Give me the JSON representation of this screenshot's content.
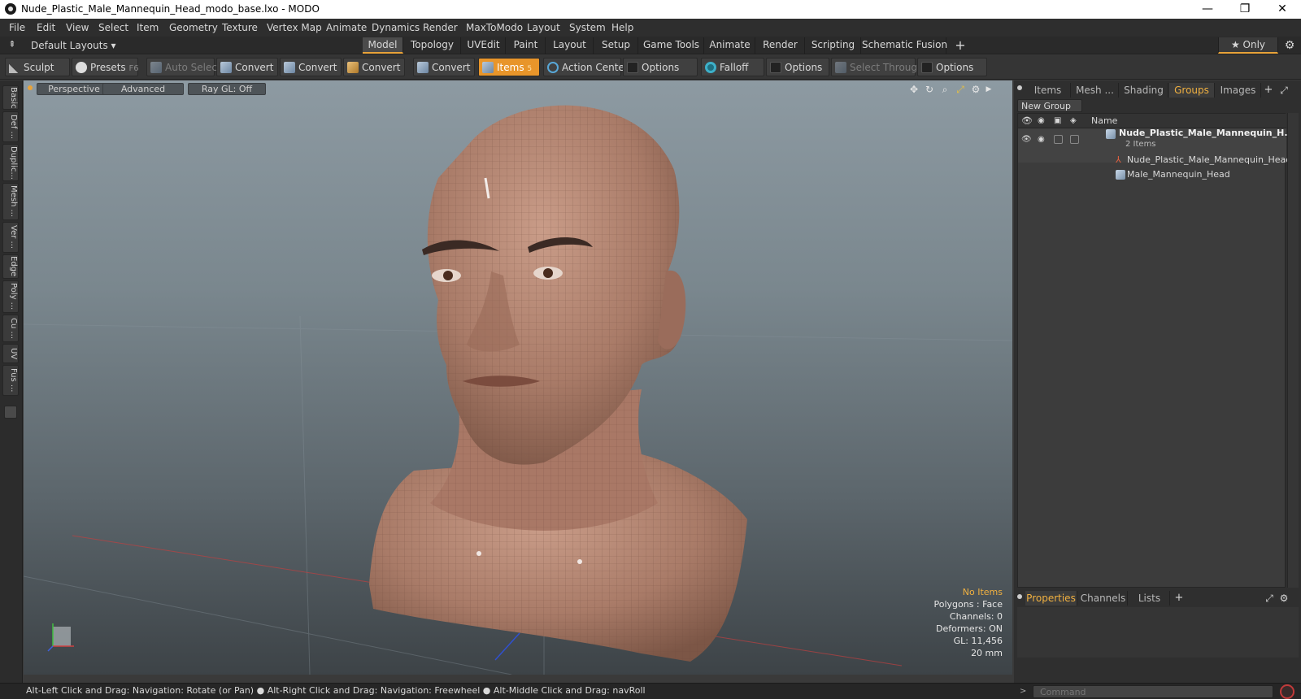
{
  "window": {
    "title": "Nude_Plastic_Male_Mannequin_Head_modo_base.lxo - MODO",
    "minimize": "—",
    "restore": "❐",
    "close": "✕"
  },
  "menu": [
    "File",
    "Edit",
    "View",
    "Select",
    "Item",
    "Geometry",
    "Texture",
    "Vertex Map",
    "Animate",
    "Dynamics",
    "Render",
    "MaxToModo",
    "Layout",
    "System",
    "Help"
  ],
  "layouts": {
    "selector": "Default Layouts ▾",
    "tabs": [
      "Model",
      "Topology",
      "UVEdit",
      "Paint",
      "Layout",
      "Setup",
      "Game Tools",
      "Animate",
      "Render",
      "Scripting",
      "Schematic Fusion"
    ],
    "active_tab": "Model",
    "add": "+",
    "only": "★ Only"
  },
  "toolbar": {
    "sculpt": "Sculpt",
    "presets": "Presets",
    "presets_key": "F6",
    "auto_select": "Auto Select",
    "convert1": "Convert",
    "convert2": "Convert",
    "convert3": "Convert",
    "convert4": "Convert",
    "items": "Items",
    "items_key": "5",
    "action_center": "Action Center",
    "options1": "Options",
    "falloff": "Falloff",
    "options2": "Options",
    "select_through": "Select Through",
    "options3": "Options"
  },
  "left_tabs": [
    "Basic",
    "Def ...",
    "Duplic...",
    "Mesh ...",
    "Ver ...",
    "Edge",
    "Poly ...",
    "Cu ...",
    "UV",
    "Fus ..."
  ],
  "viewport": {
    "view_mode": "Perspective",
    "advanced": "Advanced",
    "raygl": "Ray GL: Off",
    "stats": {
      "no_items": "No Items",
      "polygons": "Polygons : Face",
      "channels": "Channels: 0",
      "deformers": "Deformers: ON",
      "gl": "GL: 11,456",
      "scale": "20 mm"
    },
    "colors": {
      "skin": "#b88a78",
      "skin_dark": "#8d6656",
      "wire": "#6e4a3e",
      "hair": "#3b2a24",
      "highlight": "#f0b040"
    }
  },
  "right_panel": {
    "tabs": [
      "Items",
      "Mesh ...",
      "Shading",
      "Groups",
      "Images"
    ],
    "active_tab": "Groups",
    "add": "+",
    "new_group": "New Group",
    "name_header": "Name",
    "group": {
      "name": "Nude_Plastic_Male_Mannequin_H...",
      "count": "2 Items",
      "children": [
        "Nude_Plastic_Male_Mannequin_Head",
        "Male_Mannequin_Head"
      ]
    },
    "bottom_tabs": [
      "Properties",
      "Channels",
      "Lists"
    ],
    "bottom_active": "Properties",
    "bottom_add": "+"
  },
  "status": {
    "hint": "Alt-Left Click and Drag: Navigation: Rotate (or Pan) ● Alt-Right Click and Drag: Navigation: Freewheel ● Alt-Middle Click and Drag: navRoll",
    "command_placeholder": "Command"
  }
}
